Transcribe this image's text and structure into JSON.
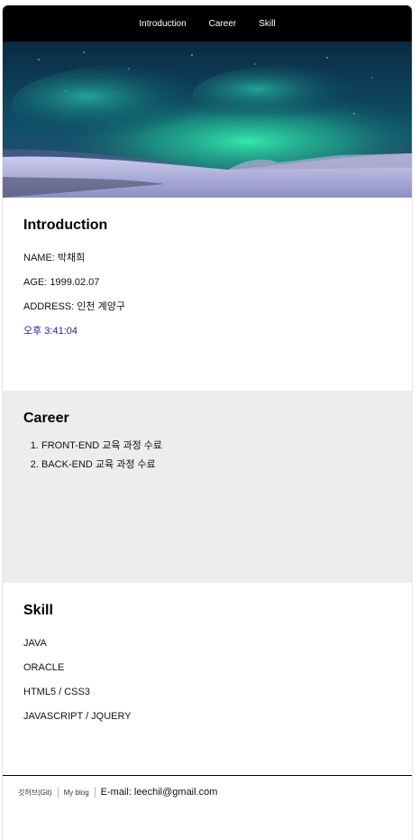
{
  "nav": {
    "items": [
      {
        "label": "Introduction"
      },
      {
        "label": "Career"
      },
      {
        "label": "Skill"
      }
    ]
  },
  "intro": {
    "title": "Introduction",
    "name": "NAME: 박채희",
    "age": "AGE: 1999.02.07",
    "address": "ADDRESS: 인천 계양구",
    "time": "오후 3:41:04"
  },
  "career": {
    "title": "Career",
    "items": [
      "FRONT-END 교육 과정 수료",
      "BACK-END 교육 과정 수료"
    ]
  },
  "skill": {
    "title": "Skill",
    "items": [
      "JAVA",
      "ORACLE",
      "HTML5 / CSS3",
      "JAVASCRIPT / JQUERY"
    ]
  },
  "footer": {
    "github": "깃허브(Git)",
    "blog": "My blog",
    "email": "E-mail: leechil@gmail.com"
  }
}
